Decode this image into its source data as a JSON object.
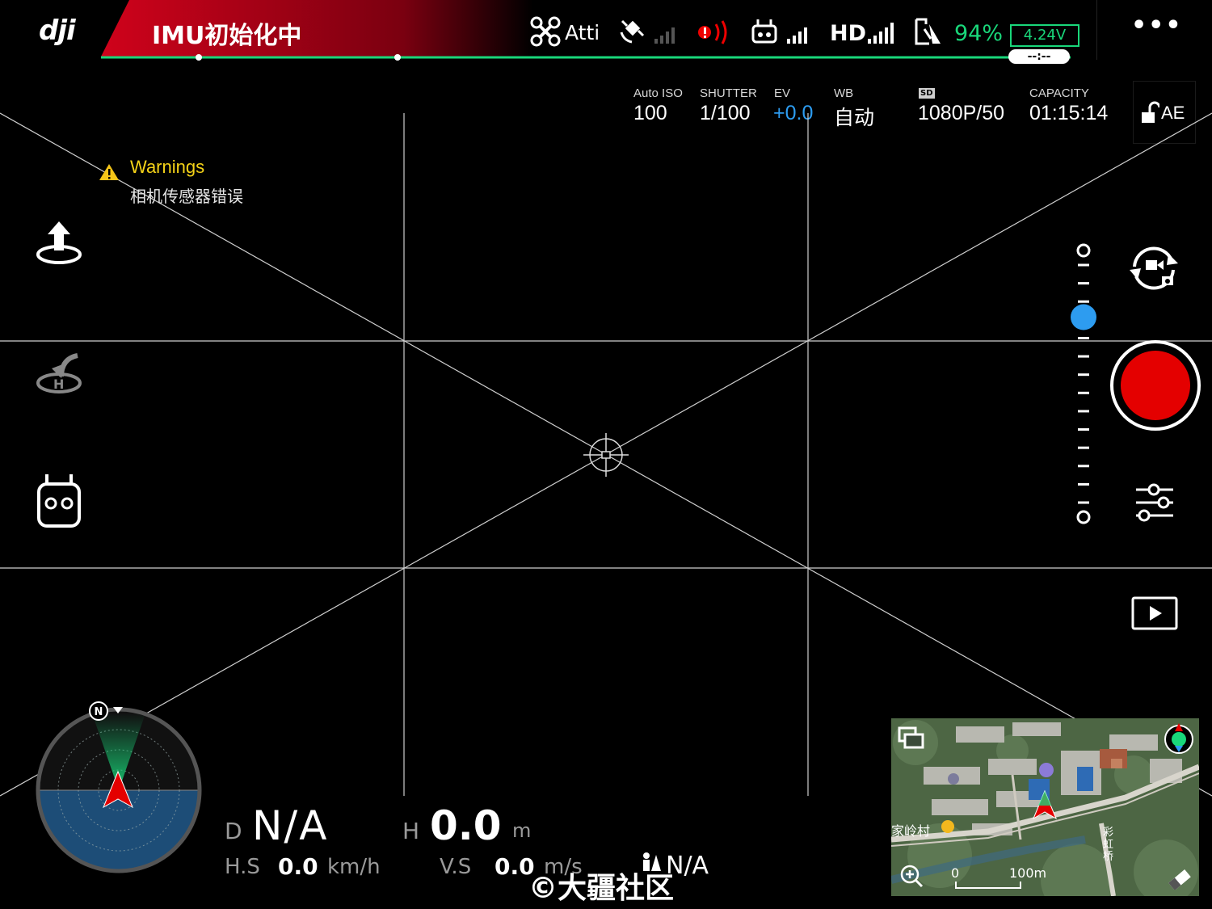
{
  "status_bar": {
    "brand": "dji",
    "system_status": "IMU初始化中",
    "flight_mode": "Atti",
    "battery_percent": "94%",
    "battery_voltage": "4.24V",
    "flight_time": "--:--",
    "hd_label": "HD",
    "menu_label": "•••",
    "colors": {
      "status_red": "#d0021b",
      "battery_green": "#19d77a"
    }
  },
  "camera": {
    "iso_label": "Auto ISO",
    "iso_value": "100",
    "shutter_label": "SHUTTER",
    "shutter_value": "1/100",
    "ev_label": "EV",
    "ev_value": "+0.0",
    "wb_label": "WB",
    "wb_value": "自动",
    "sd_label": "SD",
    "resolution_value": "1080P/50",
    "capacity_label": "CAPACITY",
    "capacity_value": "01:15:14",
    "ae_label": "AE"
  },
  "warning": {
    "title": "Warnings",
    "message": "相机传感器错误"
  },
  "telemetry": {
    "d_label": "D",
    "d_value": "N/A",
    "h_label": "H",
    "h_value": "0.0",
    "h_unit": "m",
    "hs_label": "H.S",
    "hs_value": "0.0",
    "hs_unit": "km/h",
    "vs_label": "V.S",
    "vs_value": "0.0",
    "vs_unit": "m/s",
    "vps_value": "N/A"
  },
  "compass": {
    "north_label": "N"
  },
  "map": {
    "village_label": "家岭村",
    "bridge_label": "彩虹桥",
    "scale_zero": "0",
    "scale_label": "100m"
  },
  "watermark": "©大疆社区",
  "slider": {
    "level": 0.25
  }
}
